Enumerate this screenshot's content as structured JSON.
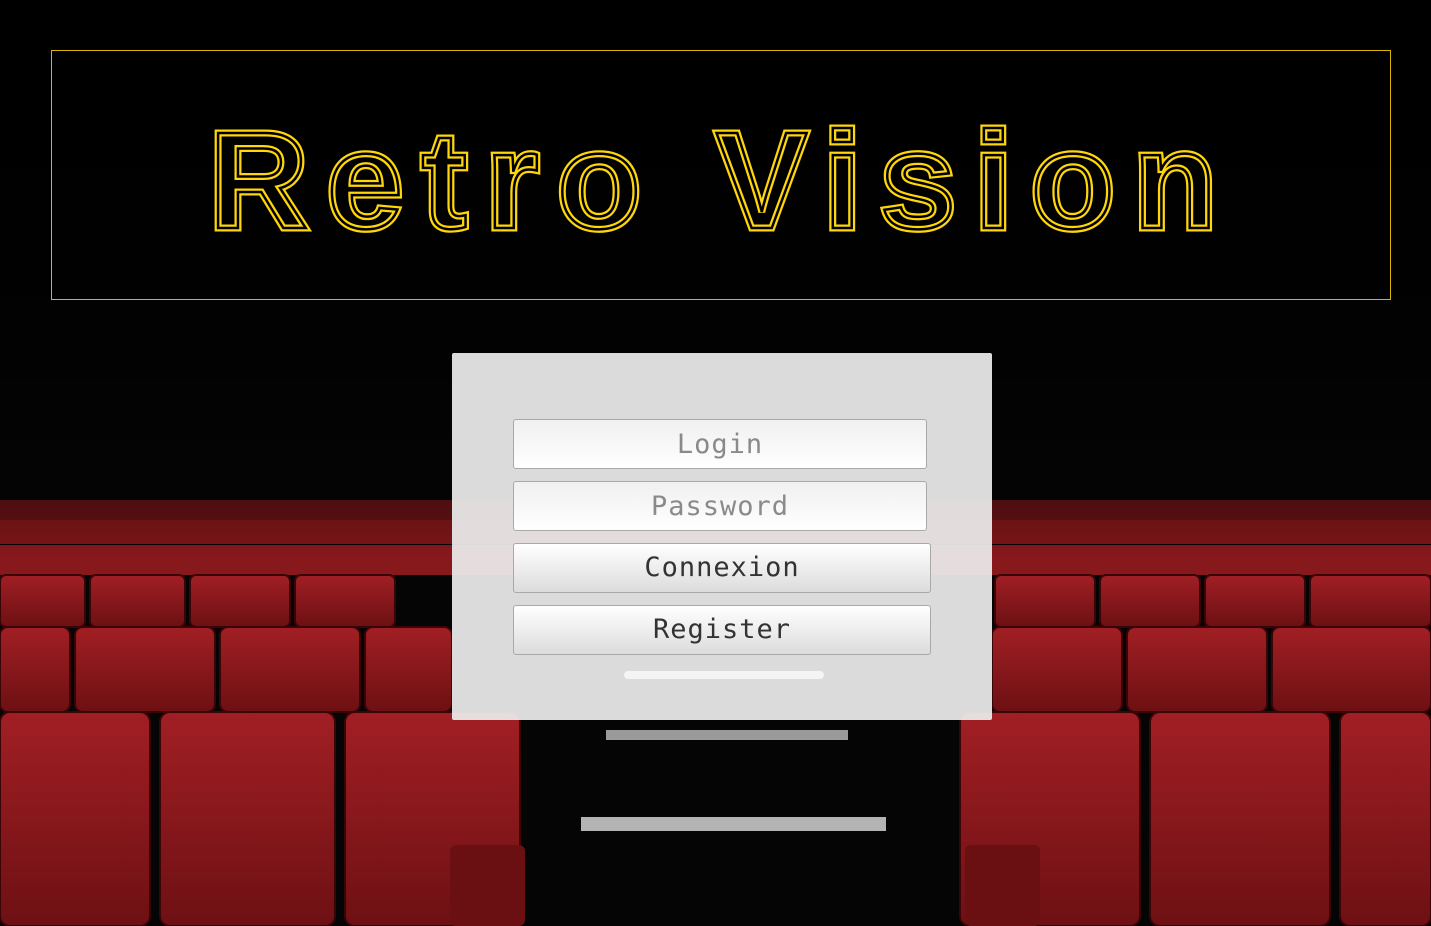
{
  "header": {
    "logo_text": "Retro Vision",
    "accent_color": "#ffd60a"
  },
  "login_form": {
    "login_placeholder": "Login",
    "password_placeholder": "Password",
    "connexion_label": "Connexion",
    "register_label": "Register"
  },
  "background": {
    "description_icon": "cinema-seats-image",
    "seat_color": "#8e1a1d"
  }
}
